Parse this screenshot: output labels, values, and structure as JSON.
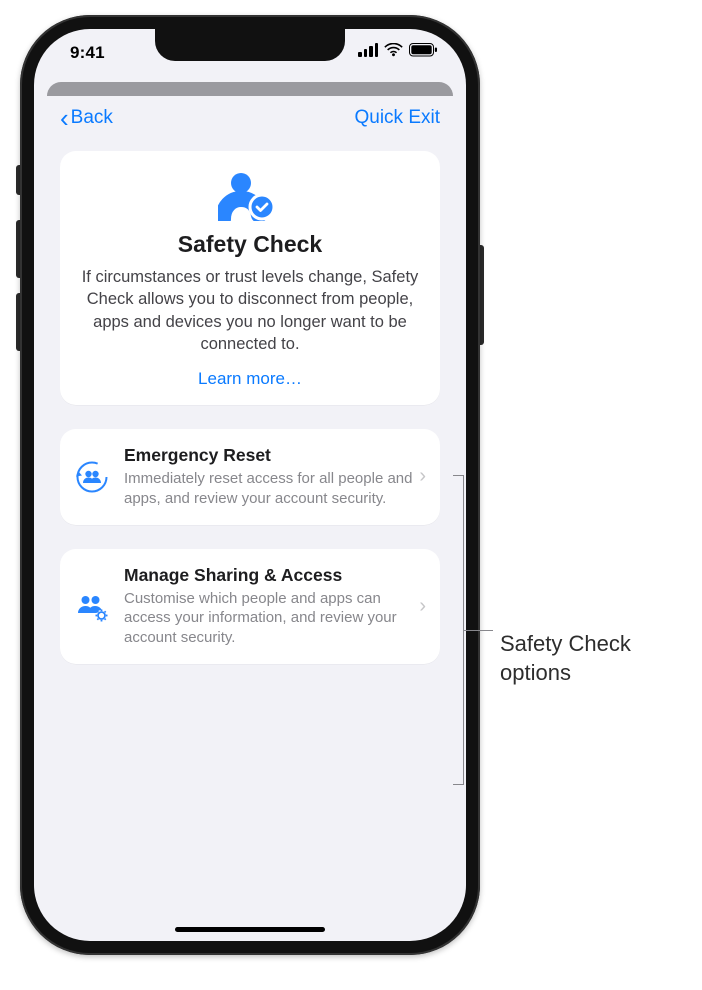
{
  "status_bar": {
    "time": "9:41"
  },
  "nav": {
    "back_label": "Back",
    "quick_exit_label": "Quick Exit"
  },
  "hero": {
    "title": "Safety Check",
    "description": "If circumstances or trust levels change, Safety Check allows you to disconnect from people, apps and devices you no longer want to be connected to.",
    "learn_more_label": "Learn more…"
  },
  "options": {
    "emergency_reset": {
      "title": "Emergency Reset",
      "desc": "Immediately reset access for all people and apps, and review your account security."
    },
    "manage_sharing": {
      "title": "Manage Sharing & Access",
      "desc": "Customise which people and apps can access your information, and review your account security."
    }
  },
  "callout": {
    "line1": "Safety Check",
    "line2": "options"
  }
}
